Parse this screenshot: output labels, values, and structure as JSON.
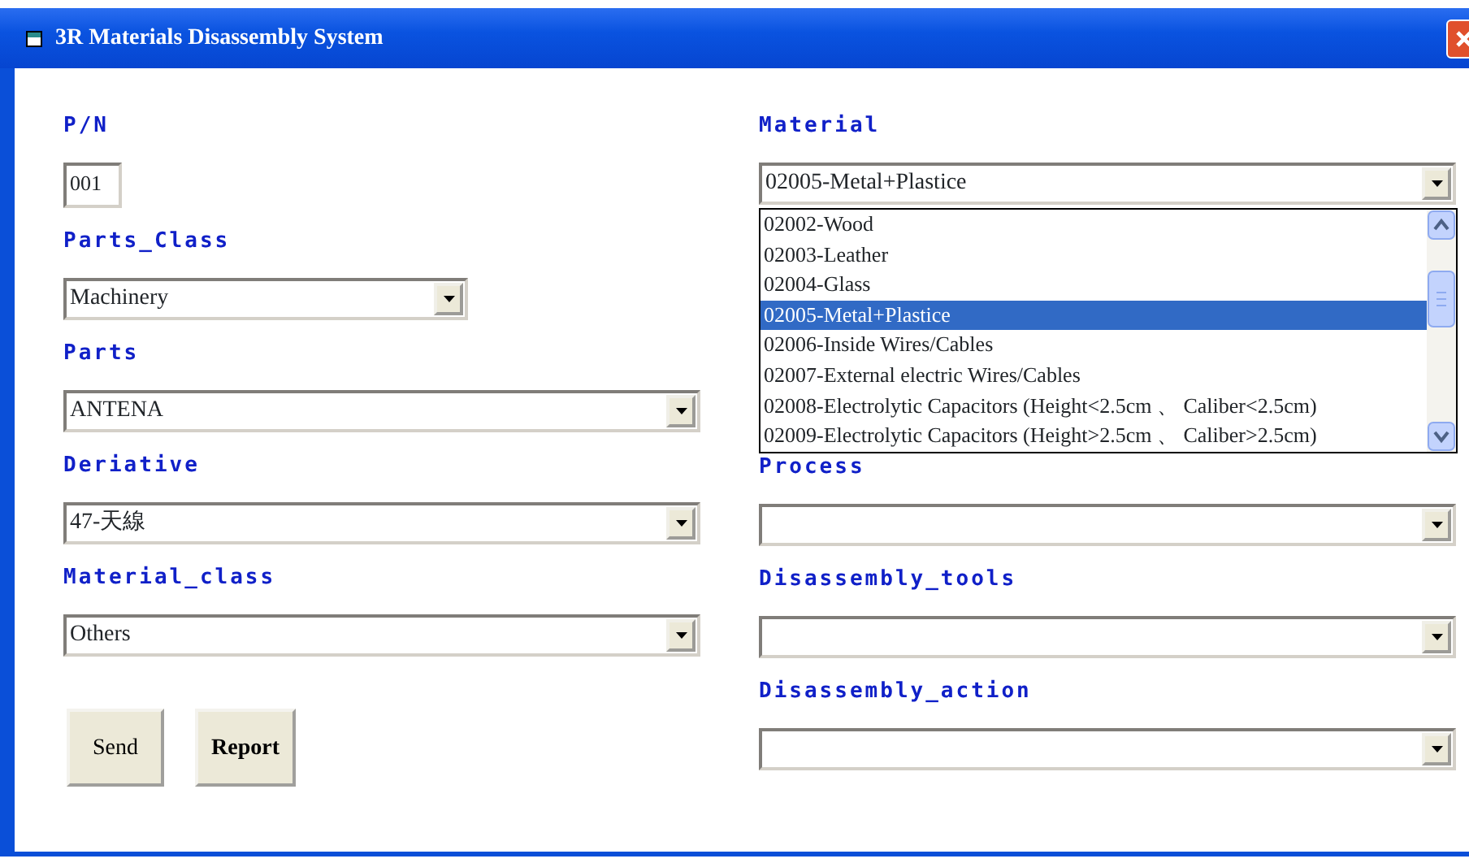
{
  "window": {
    "title": "3R Materials Disassembly System"
  },
  "left_fields": [
    {
      "label": "P/N",
      "kind": "text",
      "value": "001"
    },
    {
      "label": "Parts_Class",
      "kind": "compact-select",
      "value": "Machinery"
    },
    {
      "label": "Parts",
      "kind": "select",
      "value": "ANTENA"
    },
    {
      "label": "Deriative",
      "kind": "select",
      "value": "47-天線"
    },
    {
      "label": "Material_class",
      "kind": "select",
      "value": "Others"
    }
  ],
  "buttons": [
    {
      "label": "Send",
      "bold": false
    },
    {
      "label": "Report",
      "bold": true
    }
  ],
  "right_fields": [
    {
      "label": "Material",
      "kind": "select",
      "value": "02005-Metal+Plastice",
      "expanded": true,
      "options": [
        {
          "label": "02002-Wood",
          "selected": false
        },
        {
          "label": "02003-Leather",
          "selected": false
        },
        {
          "label": "02004-Glass",
          "selected": false
        },
        {
          "label": "02005-Metal+Plastice",
          "selected": true
        },
        {
          "label": "02006-Inside Wires/Cables",
          "selected": false
        },
        {
          "label": "02007-External electric Wires/Cables",
          "selected": false
        },
        {
          "label": "02008-Electrolytic Capacitors (Height<2.5cm 、 Caliber<2.5cm)",
          "selected": false
        },
        {
          "label": "02009-Electrolytic Capacitors (Height>2.5cm 、 Caliber>2.5cm)",
          "selected": false
        }
      ]
    },
    {
      "label": "Process",
      "kind": "select"
    },
    {
      "label": "Disassembly_tools",
      "kind": "select"
    },
    {
      "label": "Disassembly_action",
      "kind": "select"
    }
  ]
}
